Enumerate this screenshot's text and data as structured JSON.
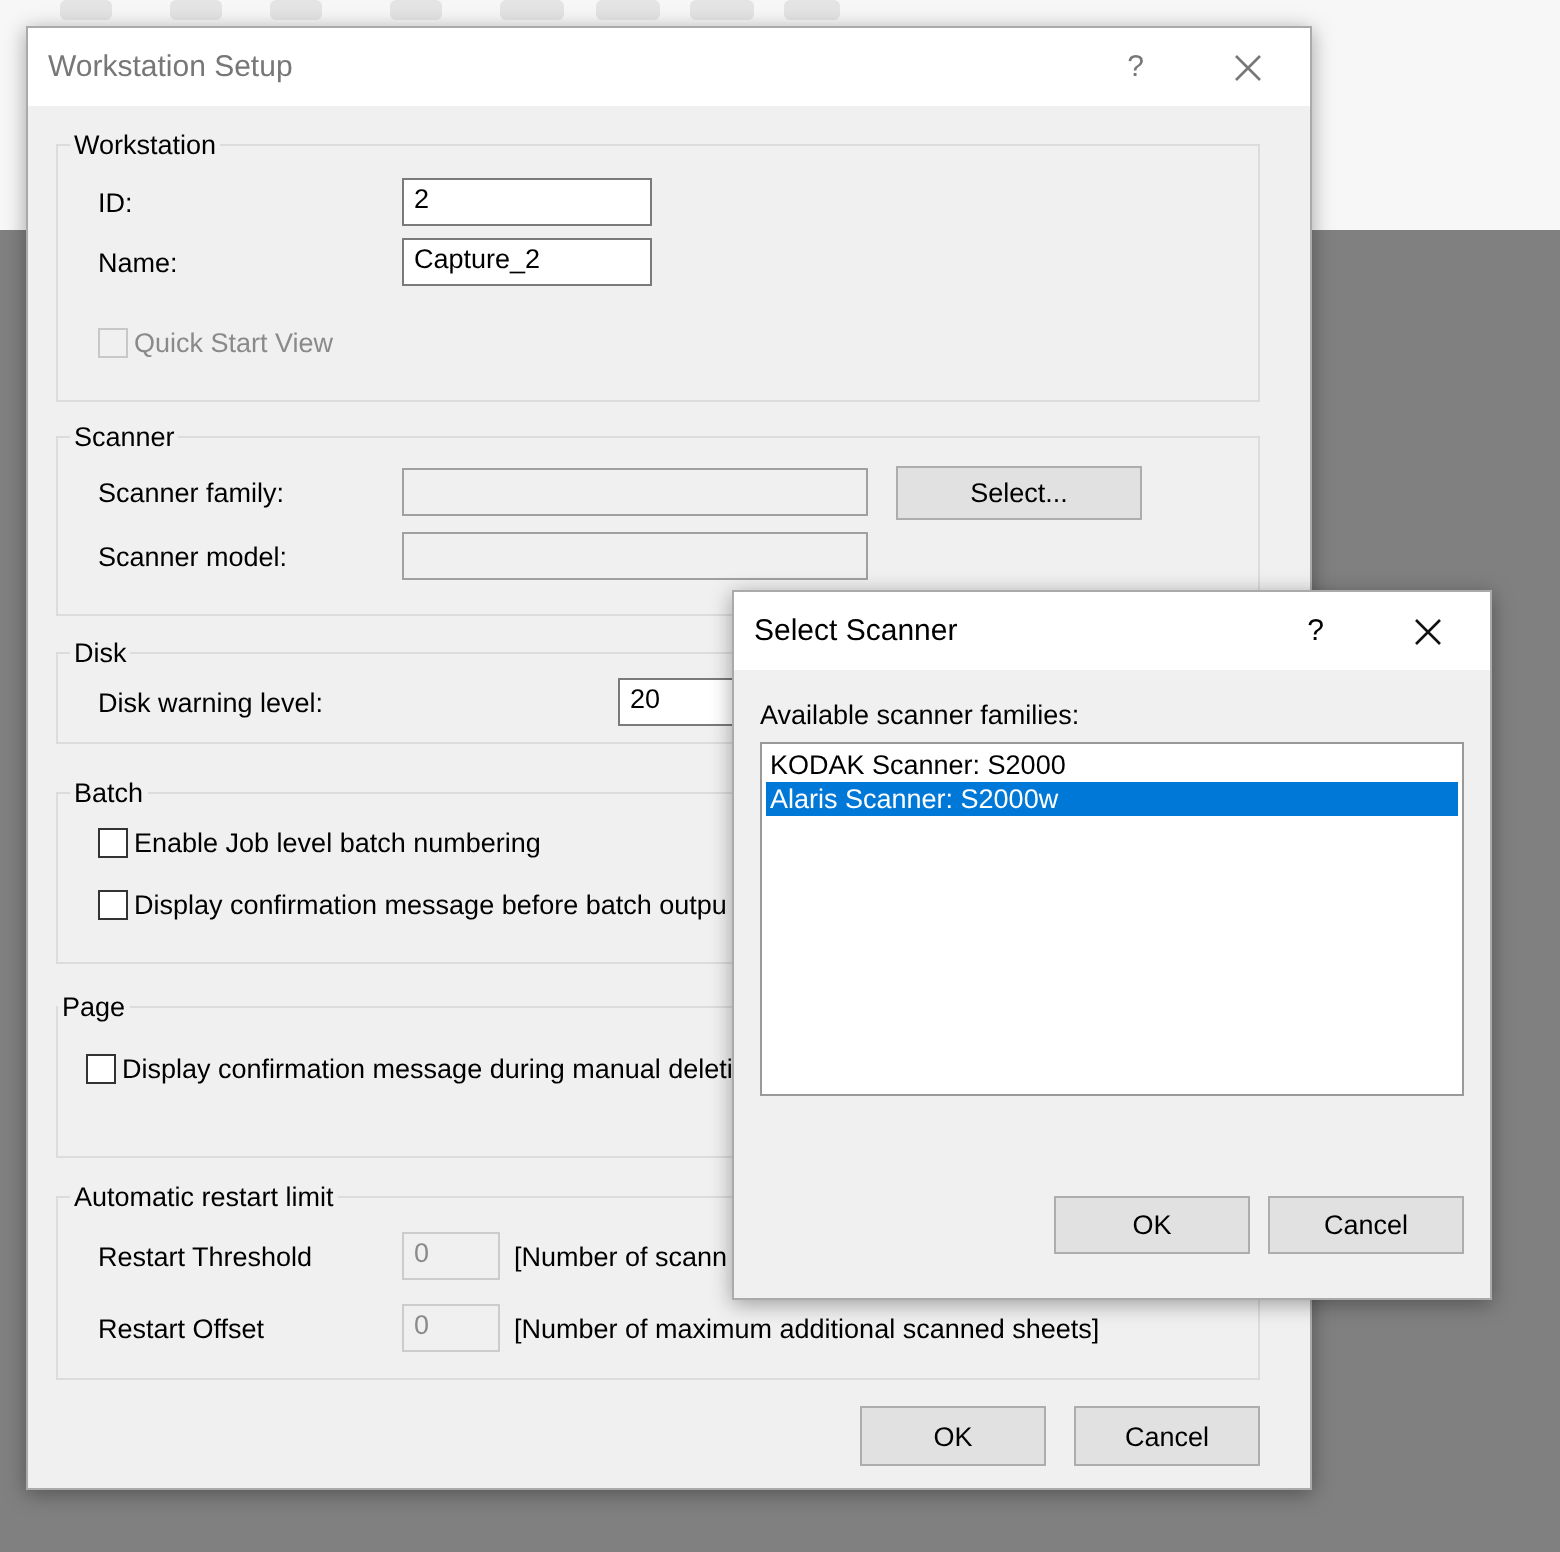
{
  "workstation_setup": {
    "title": "Workstation Setup",
    "help": "?",
    "groups": [
      {
        "kind": "workstation",
        "title": "Workstation",
        "rows": [
          {
            "kind": "field",
            "label": "ID:",
            "value": "2"
          },
          {
            "kind": "field",
            "label": "Name:",
            "value": "Capture_2"
          },
          {
            "kind": "checkbox",
            "label": "Quick Start View",
            "checked": false,
            "disabled": true
          }
        ]
      },
      {
        "kind": "scanner",
        "title": "Scanner",
        "rows": [
          {
            "kind": "select",
            "label": "Scanner family:",
            "button": "Select..."
          },
          {
            "kind": "select",
            "label": "Scanner model:"
          }
        ]
      },
      {
        "kind": "disk",
        "title": "Disk",
        "rows": [
          {
            "kind": "field",
            "label": "Disk warning level:",
            "value": "20"
          }
        ]
      },
      {
        "kind": "batch",
        "title": "Batch",
        "rows": [
          {
            "kind": "checkbox",
            "label": "Enable Job level batch numbering",
            "checked": false,
            "disabled": false
          },
          {
            "kind": "checkbox",
            "label": "Display confirmation message before batch outpu",
            "checked": false,
            "disabled": false
          }
        ]
      },
      {
        "kind": "page",
        "title": "Page",
        "rows": [
          {
            "kind": "checkbox",
            "label": "Display confirmation message during manual deleti",
            "checked": false,
            "disabled": false
          }
        ]
      },
      {
        "kind": "restart",
        "title": "Automatic restart limit",
        "rows": [
          {
            "kind": "limit",
            "label": "Restart Threshold",
            "value": "0",
            "note": "[Number of scann",
            "disabled": true
          },
          {
            "kind": "limit",
            "label": "Restart Offset",
            "value": "0",
            "note": "[Number of maximum additional scanned sheets]",
            "disabled": true
          }
        ]
      }
    ],
    "buttons": [
      {
        "label": "OK"
      },
      {
        "label": "Cancel"
      }
    ]
  },
  "select_scanner": {
    "title": "Select Scanner",
    "help": "?",
    "list_label": "Available scanner families:",
    "items": [
      {
        "label": "KODAK Scanner: S2000",
        "selected": false
      },
      {
        "label": "Alaris Scanner: S2000w",
        "selected": true
      }
    ],
    "buttons": [
      {
        "label": "OK"
      },
      {
        "label": "Cancel"
      }
    ]
  }
}
